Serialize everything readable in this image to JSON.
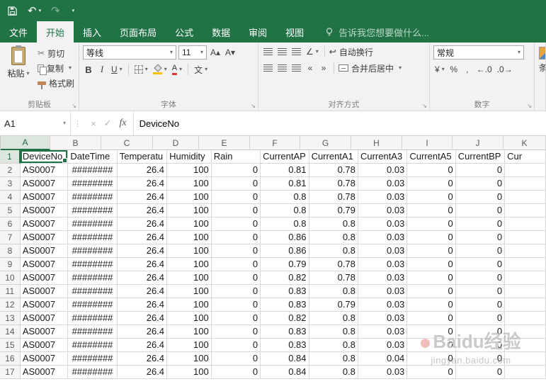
{
  "icons": {
    "caret": "▾",
    "undo": "↶",
    "redo": "↷",
    "scissors": "✂",
    "dialog_launcher": "↘",
    "handle_dots": "⋮",
    "cancel": "×",
    "enter": "✓",
    "fx": "fx",
    "orientation": "∠",
    "indent_decrease": "«",
    "indent_increase": "»",
    "wrap_arrow": "↩",
    "grow_font": "A▴",
    "shrink_font": "A▾",
    "currency": "¥",
    "percent": "%",
    "comma": ",",
    "increase_decimal": "←.0",
    "decrease_decimal": ".0→"
  },
  "tabs": [
    {
      "label": "文件",
      "active": false
    },
    {
      "label": "开始",
      "active": true
    },
    {
      "label": "插入",
      "active": false
    },
    {
      "label": "页面布局",
      "active": false
    },
    {
      "label": "公式",
      "active": false
    },
    {
      "label": "数据",
      "active": false
    },
    {
      "label": "审阅",
      "active": false
    },
    {
      "label": "视图",
      "active": false
    }
  ],
  "tell_me": "告诉我您想要做什么...",
  "ribbon": {
    "clipboard": {
      "label": "剪贴板",
      "paste": "粘贴",
      "cut": "剪切",
      "copy": "复制",
      "format_painter": "格式刷"
    },
    "font": {
      "label": "字体",
      "font_name": "等线",
      "font_size": "11",
      "bold": "B",
      "italic": "I",
      "underline": "U",
      "phonetic": "文"
    },
    "alignment": {
      "label": "对齐方式",
      "wrap_text": "自动换行",
      "merge_center": "合并后居中"
    },
    "number": {
      "label": "数字",
      "format": "常规"
    },
    "styles": {
      "conditional_formatting": "条件格式"
    }
  },
  "formula_bar": {
    "name_box": "A1",
    "value": "DeviceNo"
  },
  "grid": {
    "selection": {
      "cell": "A1",
      "column": "A",
      "row": 1
    },
    "column_letters": [
      "A",
      "B",
      "C",
      "D",
      "E",
      "F",
      "G",
      "H",
      "I",
      "J",
      "K"
    ],
    "sheet_rows": [
      [
        "DeviceNo",
        "DateTime",
        "Temperatu",
        "Humidity",
        "Rain",
        "CurrentAP",
        "CurrentA1",
        "CurrentA3",
        "CurrentA5",
        "CurrentBP",
        "Cur"
      ],
      [
        "AS0007",
        "########",
        "26.4",
        "100",
        "0",
        "0.81",
        "0.78",
        "0.03",
        "0",
        "0",
        ""
      ],
      [
        "AS0007",
        "########",
        "26.4",
        "100",
        "0",
        "0.81",
        "0.78",
        "0.03",
        "0",
        "0",
        ""
      ],
      [
        "AS0007",
        "########",
        "26.4",
        "100",
        "0",
        "0.8",
        "0.78",
        "0.03",
        "0",
        "0",
        ""
      ],
      [
        "AS0007",
        "########",
        "26.4",
        "100",
        "0",
        "0.8",
        "0.79",
        "0.03",
        "0",
        "0",
        ""
      ],
      [
        "AS0007",
        "########",
        "26.4",
        "100",
        "0",
        "0.8",
        "0.8",
        "0.03",
        "0",
        "0",
        ""
      ],
      [
        "AS0007",
        "########",
        "26.4",
        "100",
        "0",
        "0.86",
        "0.8",
        "0.03",
        "0",
        "0",
        ""
      ],
      [
        "AS0007",
        "########",
        "26.4",
        "100",
        "0",
        "0.86",
        "0.8",
        "0.03",
        "0",
        "0",
        ""
      ],
      [
        "AS0007",
        "########",
        "26.4",
        "100",
        "0",
        "0.79",
        "0.78",
        "0.03",
        "0",
        "0",
        ""
      ],
      [
        "AS0007",
        "########",
        "26.4",
        "100",
        "0",
        "0.82",
        "0.78",
        "0.03",
        "0",
        "0",
        ""
      ],
      [
        "AS0007",
        "########",
        "26.4",
        "100",
        "0",
        "0.83",
        "0.8",
        "0.03",
        "0",
        "0",
        ""
      ],
      [
        "AS0007",
        "########",
        "26.4",
        "100",
        "0",
        "0.83",
        "0.79",
        "0.03",
        "0",
        "0",
        ""
      ],
      [
        "AS0007",
        "########",
        "26.4",
        "100",
        "0",
        "0.82",
        "0.8",
        "0.03",
        "0",
        "0",
        ""
      ],
      [
        "AS0007",
        "########",
        "26.4",
        "100",
        "0",
        "0.83",
        "0.8",
        "0.03",
        "0",
        "0",
        ""
      ],
      [
        "AS0007",
        "########",
        "26.4",
        "100",
        "0",
        "0.83",
        "0.8",
        "0.03",
        "0",
        "0",
        ""
      ],
      [
        "AS0007",
        "########",
        "26.4",
        "100",
        "0",
        "0.84",
        "0.8",
        "0.04",
        "0",
        "0",
        ""
      ],
      [
        "AS0007",
        "########",
        "26.4",
        "100",
        "0",
        "0.84",
        "0.8",
        "0.03",
        "0",
        "0",
        ""
      ]
    ]
  },
  "watermark": {
    "line1": "Baidu经验",
    "line2": "jingyan.baidu.com"
  },
  "colors": {
    "brand_green": "#217346",
    "font_color_red": "#e03c31",
    "fill_yellow": "#ffc000"
  }
}
